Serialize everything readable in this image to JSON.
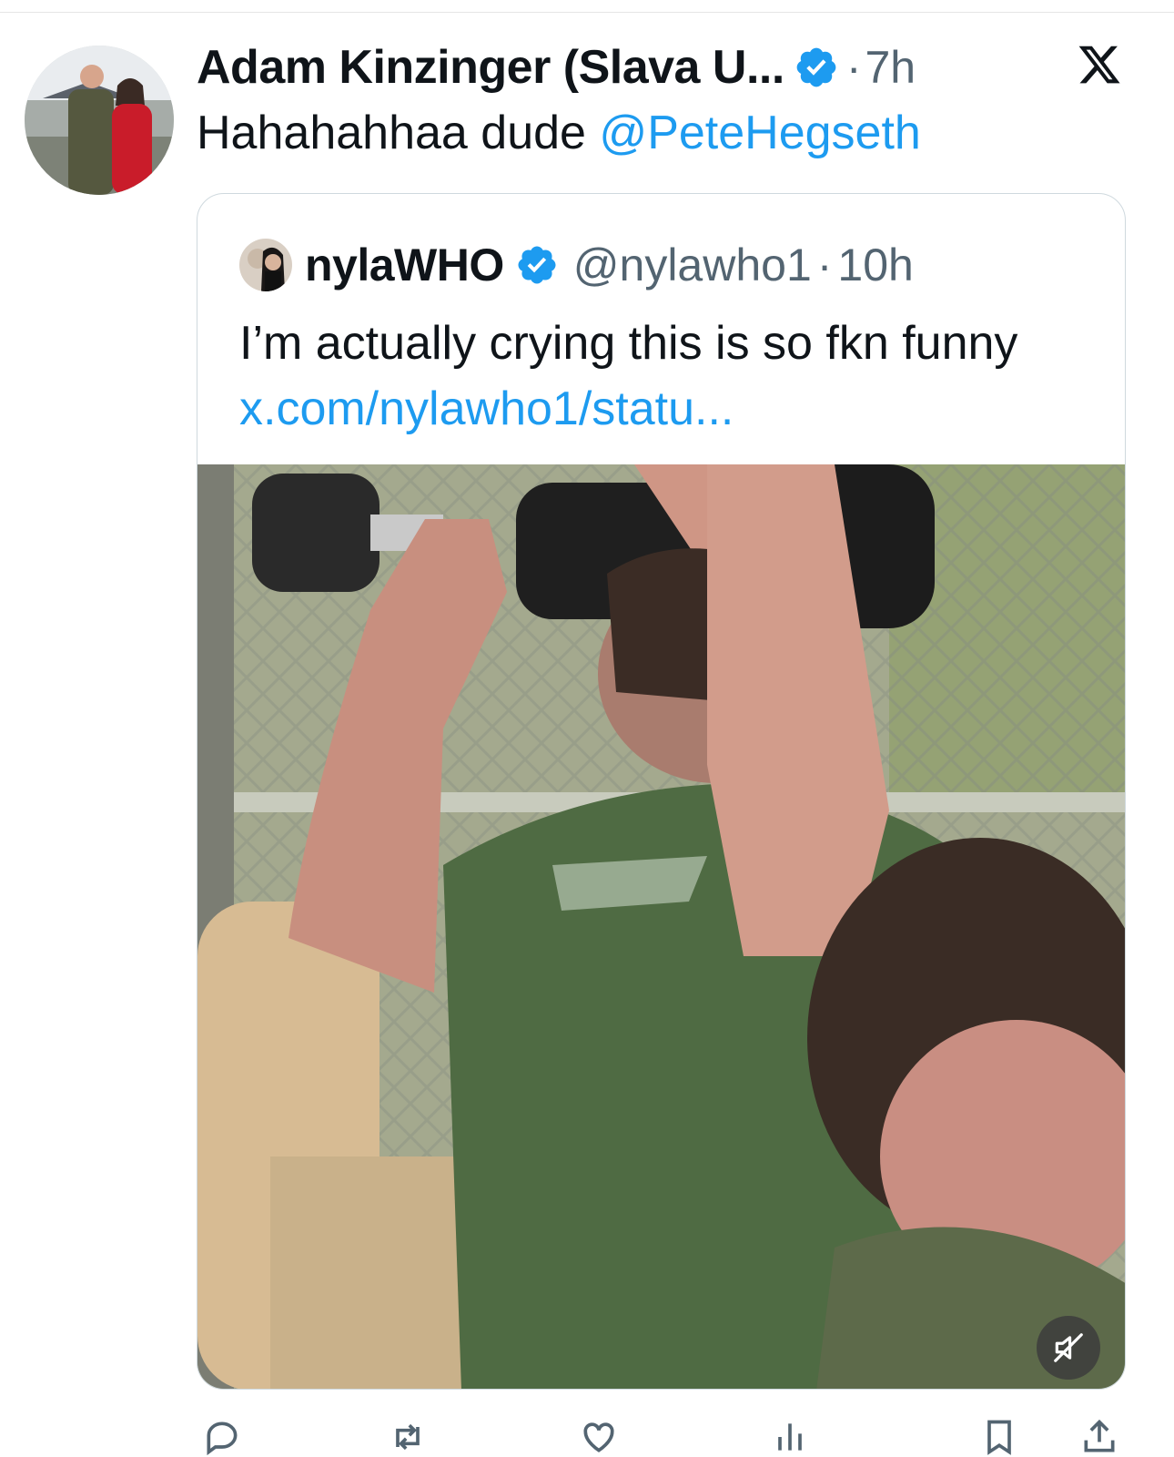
{
  "app": "X",
  "post": {
    "author_name": "Adam Kinzinger (Slava U...",
    "separator": "·",
    "time": "7h",
    "text": "Hahahahhaa dude ",
    "mention": "@PeteHegseth"
  },
  "quoted_post": {
    "author_name": "nylaWHO",
    "handle": "@nylawho1",
    "separator": "·",
    "time": "10h",
    "text": "I’m actually crying this is so fkn funny ",
    "link": "x.com/nylawho1/statu..."
  },
  "icons": {
    "verified": "verified-badge-icon",
    "logo": "x-logo-icon",
    "mute": "speaker-muted-icon",
    "actions": [
      "reply-icon",
      "repost-icon",
      "like-icon",
      "views-icon",
      "bookmark-icon",
      "share-icon"
    ]
  },
  "colors": {
    "link": "#1d9bf0",
    "verified": "#1d9bf0",
    "secondary_text": "#536471",
    "border": "#cfd9de"
  }
}
